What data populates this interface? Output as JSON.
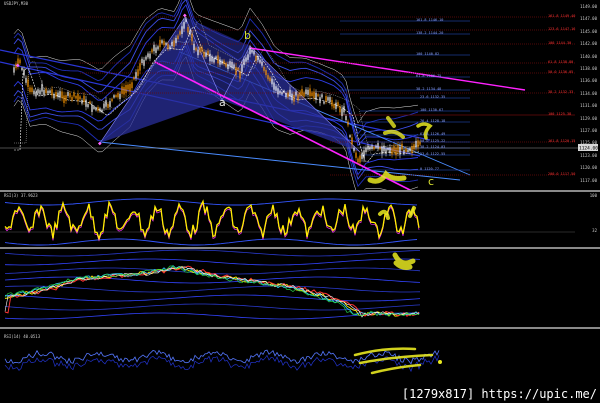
{
  "chart_header": "USDJPY,M30",
  "rsi_header": "RSI(3) 37.9623",
  "rsi14_header": "RSI(14) 40.0513",
  "price_ticks": [
    "1149.00",
    "1147.00",
    "1145.00",
    "1142.00",
    "1140.00",
    "1138.00",
    "1136.00",
    "1134.00",
    "1131.00",
    "1129.00",
    "1127.00",
    "1125.00",
    "1123.00",
    "1120.00",
    "1117.00"
  ],
  "rsi_ticks": [
    "100",
    "32",
    "0"
  ],
  "price_badge": "1124.00",
  "letters": {
    "a": "a",
    "b": "b",
    "c": "c"
  },
  "watermark": "[1279x817] https://upic.me/",
  "colors": {
    "bullish": "#ff9900",
    "bearish": "#ffffff",
    "pattern_fill": "#2a2f9a",
    "magenta": "#ff22ff",
    "fib_red": "#cc1111",
    "fib_blue": "#3a6cff",
    "annotation": "#e8e820"
  },
  "fib_labels_right": [
    {
      "text": "161.8 1149.40",
      "color": "red"
    },
    {
      "text": "123.6 1147.16",
      "color": "red"
    },
    {
      "text": "100 1144.30",
      "color": "red"
    },
    {
      "text": "61.8 1138.80",
      "color": "red"
    },
    {
      "text": "50.0 1136.05",
      "color": "red"
    },
    {
      "text": "38.2 1132.33",
      "color": "red"
    },
    {
      "text": "100 1125.38",
      "color": "red"
    },
    {
      "text": "161.8 1120.15",
      "color": "red"
    },
    {
      "text": "200.0 1117.50",
      "color": "red"
    }
  ],
  "fib_labels_blue": [
    {
      "text": "161.8 1146.10"
    },
    {
      "text": "138.2 1144.20"
    },
    {
      "text": "100 1140.82"
    },
    {
      "text": "61.8 1136.75"
    },
    {
      "text": "38.2 1134.48"
    },
    {
      "text": "23.6 1132.35"
    },
    {
      "text": "100 1130.67"
    },
    {
      "text": "76.4 1128.18"
    },
    {
      "text": "61.8 1126.49"
    },
    {
      "text": "50.0 1125.22"
    },
    {
      "text": "38.2 1124.03"
    },
    {
      "text": "23.6 1122.55"
    },
    {
      "text": "0 1120.77"
    }
  ]
}
